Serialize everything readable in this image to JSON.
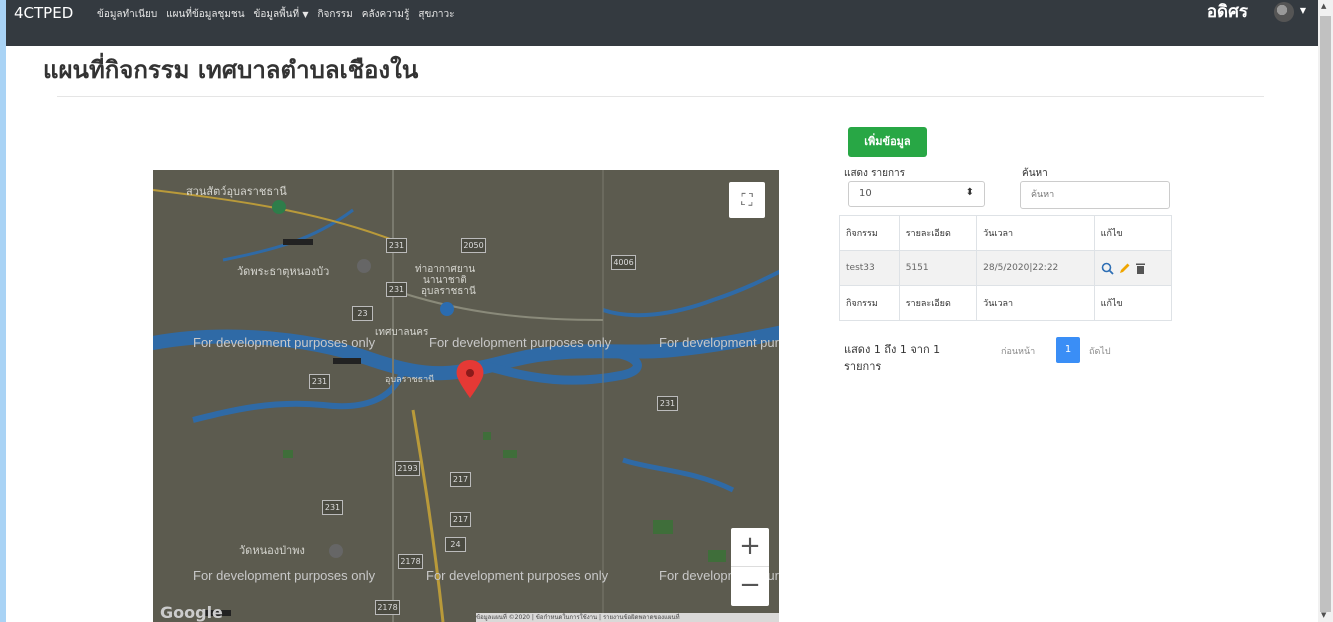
{
  "navbar": {
    "brand": "4CTPED",
    "links": [
      "ข้อมูลทำเนียบ",
      "แผนที่ข้อมูลชุมชน",
      "ข้อมูลพื้นที่",
      "กิจกรรม",
      "คลังความรู้",
      "สุขภาวะ"
    ],
    "user_name": "อดิศร"
  },
  "page": {
    "title": "แผนที่กิจกรรม เทศบาลตำบลเชืองใน"
  },
  "map": {
    "dev_watermark": "For development purposes only",
    "labels": [
      "สวนสัตว์อุบลราชธานี",
      "วัดพระธาตุหนองบัว",
      "ท่าอากาศยาน",
      "นานาชาติ",
      "อุบลราชธานี",
      "เทศบาลนคร",
      "อุบลราชธานี",
      "วัดหนองป่าพง"
    ],
    "shields": [
      "231",
      "2050",
      "4006",
      "231",
      "23",
      "231",
      "2193",
      "217",
      "217",
      "231",
      "2178",
      "24",
      "231",
      "2178"
    ],
    "google_logo": "Google",
    "footer": "ข้อมูลแผนที่ ©2020 | ข้อกำหนดในการใช้งาน | รายงานข้อผิดพลาดของแผนที่",
    "icons": {
      "fullscreen": "fullscreen-icon",
      "zoom_in": "+",
      "zoom_out": "−"
    }
  },
  "panel": {
    "add_button": "เพิ่มข้อมูล",
    "length_label": "แสดง รายการ",
    "length_value": "10",
    "search_label": "ค้นหา",
    "search_placeholder": "ค้นหา",
    "table": {
      "headers": [
        "กิจกรรม",
        "รายละเอียด",
        "วันเวลา",
        "แก้ไข"
      ],
      "rows": [
        {
          "activity": "test33",
          "detail": "5151",
          "datetime": "28/5/2020|22:22"
        }
      ],
      "footers": [
        "กิจกรรม",
        "รายละเอียด",
        "วันเวลา",
        "แก้ไข"
      ]
    },
    "info": "แสดง 1 ถึง 1 จาก 1 รายการ",
    "pager": {
      "prev": "ก่อนหน้า",
      "page": "1",
      "next": "ถัดไป"
    }
  },
  "colors": {
    "navbar": "#343a40",
    "add_button": "#28a745",
    "pager_active": "#3a8ef6",
    "edit_icon": "#f0a500",
    "marker": "#e53935"
  }
}
